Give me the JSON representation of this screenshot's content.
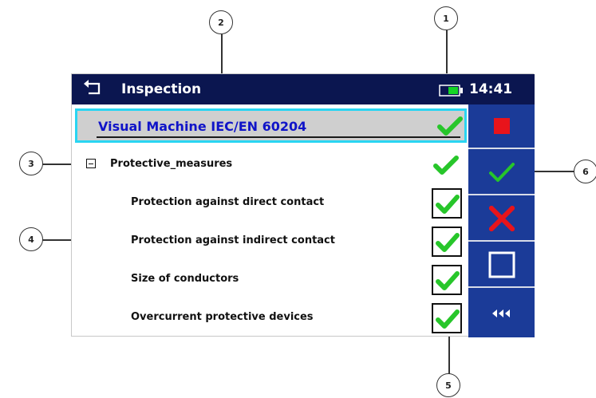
{
  "header": {
    "title": "Inspection",
    "time": "14:41",
    "back_icon": "back-arrow-icon",
    "battery_icon": "battery-icon"
  },
  "selected": {
    "label": "Visual Machine IEC/EN 60204",
    "status": "pass"
  },
  "group": {
    "label": "Protective_measures",
    "status": "pass",
    "expanded": true
  },
  "items": [
    {
      "label": "Protection against direct contact",
      "status": "pass"
    },
    {
      "label": "Protection against indirect contact",
      "status": "pass"
    },
    {
      "label": "Size of conductors",
      "status": "pass"
    },
    {
      "label": "Overcurrent protective devices",
      "status": "pass"
    }
  ],
  "side_panel": {
    "buttons": [
      "stop-icon",
      "pass-check-icon",
      "fail-x-icon",
      "checkbox-empty-icon",
      "back-triple-arrow-icon"
    ]
  },
  "callouts": [
    "1",
    "2",
    "3",
    "4",
    "5",
    "6"
  ],
  "colors": {
    "titlebar": "#0b1650",
    "panel": "#1b3b98",
    "selection_border": "#29d5f2",
    "selected_text": "#1014c8",
    "pass_green": "#27c62a",
    "fail_red": "#e8141b"
  }
}
